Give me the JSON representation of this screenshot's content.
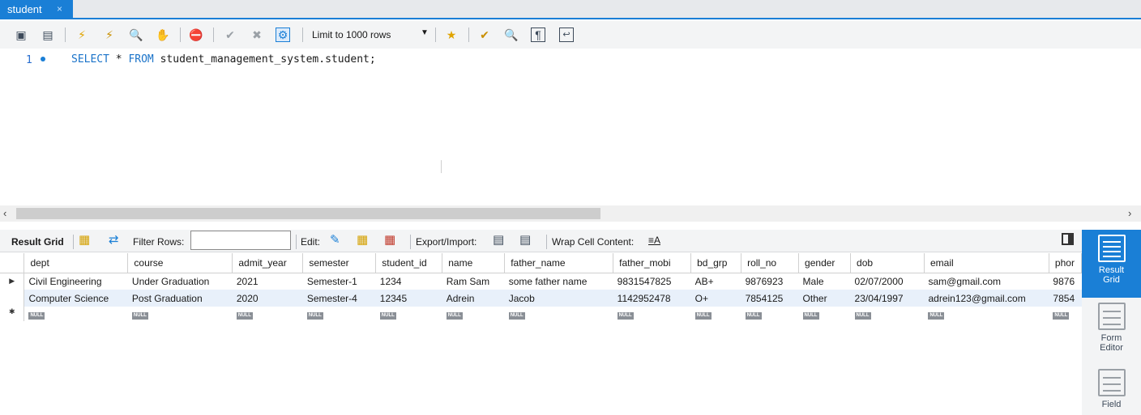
{
  "tab": {
    "title": "student",
    "close": "×"
  },
  "toolbar": {
    "limit_label": "Limit to 1000 rows",
    "icons": [
      "open-folder-icon",
      "save-icon",
      "execute-icon",
      "execute-current-icon",
      "explain-icon",
      "stop-icon",
      "toggle-error-icon",
      "commit-icon",
      "rollback-icon",
      "autocommit-icon",
      "limit-dropdown-arrow",
      "beautify-star-icon",
      "beautify-icon",
      "find-icon",
      "invisible-chars-icon",
      "wrap-icon"
    ]
  },
  "editor": {
    "line_number": "1",
    "sql_keyword_select": "SELECT",
    "sql_star": " * ",
    "sql_keyword_from": "FROM",
    "sql_rest": " student_management_system.student;"
  },
  "result_toolbar": {
    "result_grid": "Result Grid",
    "filter_rows": "Filter Rows:",
    "filter_value": "",
    "edit": "Edit:",
    "export_import": "Export/Import:",
    "wrap_cell_content": "Wrap Cell Content:"
  },
  "grid": {
    "columns": [
      "dept",
      "course",
      "admit_year",
      "semester",
      "student_id",
      "name",
      "father_name",
      "father_mobi",
      "bd_grp",
      "roll_no",
      "gender",
      "dob",
      "email",
      "phor"
    ],
    "rows": [
      [
        "Civil Engineering",
        "Under Graduation",
        "2021",
        "Semester-1",
        "1234",
        "Ram Sam",
        "some father name",
        "9831547825",
        "AB+",
        "9876923",
        "Male",
        "02/07/2000",
        "sam@gmail.com",
        "9876"
      ],
      [
        "Computer Science",
        "Post Graduation",
        "2020",
        "Semester-4",
        "12345",
        "Adrein",
        "Jacob",
        "1142952478",
        "O+",
        "7854125",
        "Other",
        "23/04/1997",
        "adrein123@gmail.com",
        "7854"
      ]
    ],
    "null_label": "NULL",
    "row_marker": "▶",
    "new_row_marker": "✱"
  },
  "side_panel": {
    "result_grid_l1": "Result",
    "result_grid_l2": "Grid",
    "form_editor_l1": "Form",
    "form_editor_l2": "Editor",
    "field_l1": "Field"
  }
}
